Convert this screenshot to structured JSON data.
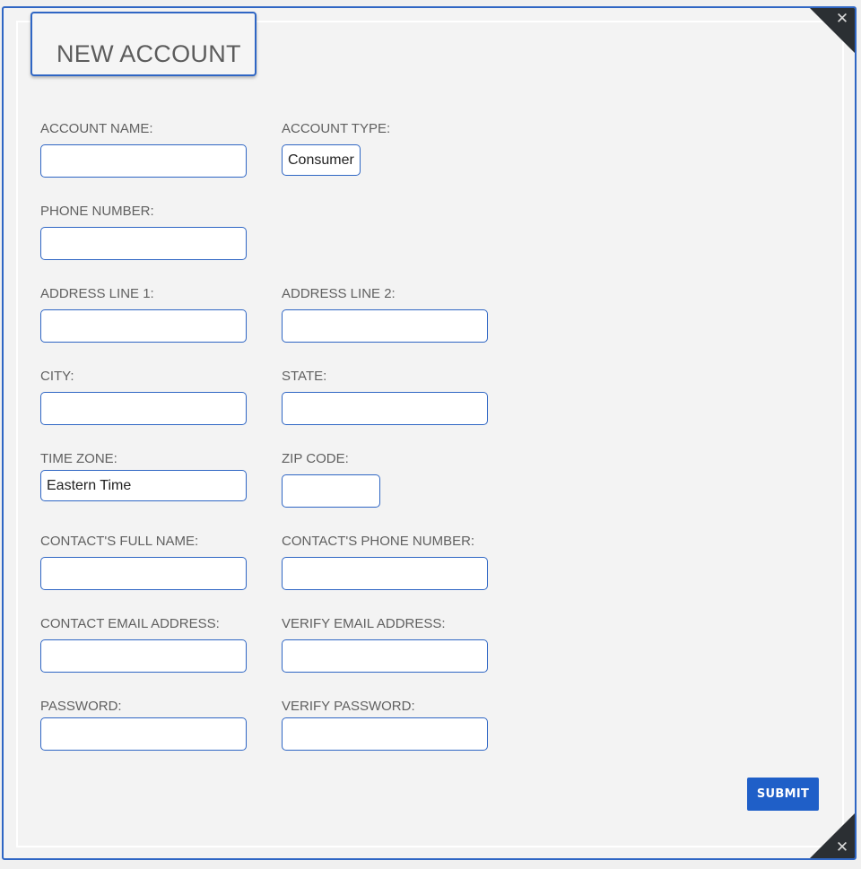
{
  "dialog": {
    "title": "NEW ACCOUNT",
    "close_glyph": "✕",
    "submit_label": "SUBMIT"
  },
  "fields": {
    "account_name": {
      "label": "ACCOUNT NAME:",
      "value": ""
    },
    "account_type": {
      "label": "ACCOUNT TYPE:",
      "value": "Consumer"
    },
    "phone_number": {
      "label": "PHONE NUMBER:",
      "value": ""
    },
    "address_line_1": {
      "label": "ADDRESS LINE 1:",
      "value": ""
    },
    "address_line_2": {
      "label": "ADDRESS LINE 2:",
      "value": ""
    },
    "city": {
      "label": "CITY:",
      "value": ""
    },
    "state": {
      "label": "STATE:",
      "value": ""
    },
    "time_zone": {
      "label": "TIME ZONE:",
      "value": "Eastern Time"
    },
    "zip_code": {
      "label": "ZIP CODE:",
      "value": ""
    },
    "contact_full_name": {
      "label": "CONTACT'S FULL NAME:",
      "value": ""
    },
    "contact_phone_number": {
      "label": "CONTACT'S PHONE NUMBER:",
      "value": ""
    },
    "contact_email": {
      "label": "CONTACT EMAIL ADDRESS:",
      "value": ""
    },
    "verify_email": {
      "label": "VERIFY EMAIL ADDRESS:",
      "value": ""
    },
    "password": {
      "label": "PASSWORD:",
      "value": ""
    },
    "verify_password": {
      "label": "VERIFY PASSWORD:",
      "value": ""
    }
  },
  "colors": {
    "accent": "#2f66c4",
    "button": "#1f5fc8",
    "corner": "#2b2f33",
    "label_text": "#606060"
  },
  "icons": {
    "close": "close-icon",
    "select": "dropdown-select"
  }
}
